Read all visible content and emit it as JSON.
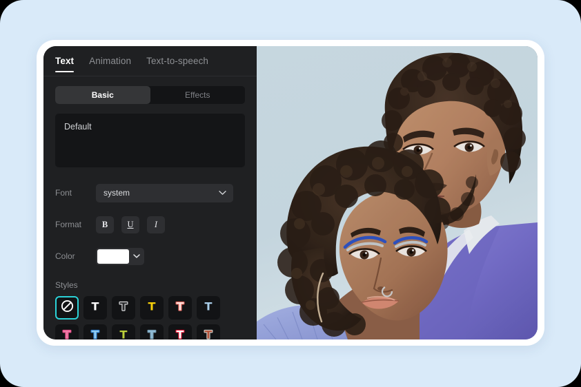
{
  "page": {
    "background_color": "#d9eaf9",
    "frame_color": "#ffffff",
    "panel_color": "#1f2022",
    "accent_color": "#2bd3d8"
  },
  "editor": {
    "tabs": [
      {
        "label": "Text",
        "active": true
      },
      {
        "label": "Animation",
        "active": false
      },
      {
        "label": "Text-to-speech",
        "active": false
      }
    ],
    "segmented": [
      {
        "label": "Basic",
        "active": true
      },
      {
        "label": "Effects",
        "active": false
      }
    ],
    "text_input": {
      "value": "Default",
      "placeholder": "Default"
    },
    "font": {
      "label": "Font",
      "value": "system",
      "chevron_icon": "chevron-down-icon"
    },
    "format": {
      "label": "Format",
      "buttons": [
        {
          "name": "bold-button",
          "glyph": "B"
        },
        {
          "name": "underline-button",
          "glyph": "U"
        },
        {
          "name": "italic-button",
          "glyph": "I"
        }
      ]
    },
    "color": {
      "label": "Color",
      "value": "#ffffff",
      "chevron_icon": "chevron-down-icon"
    },
    "styles": {
      "label": "Styles",
      "items": [
        {
          "name": "style-none",
          "icon": "no-style-icon",
          "selected": true,
          "fill": "#ffffff",
          "stroke": ""
        },
        {
          "name": "style-white",
          "icon": "text-style-icon",
          "selected": false,
          "fill": "#ffffff",
          "stroke": ""
        },
        {
          "name": "style-outline-white",
          "icon": "text-style-icon",
          "selected": false,
          "fill": "#2a2b2d",
          "stroke": "#e8e9eb"
        },
        {
          "name": "style-yellow",
          "icon": "text-style-icon",
          "selected": false,
          "fill": "#f5cf0a",
          "stroke": ""
        },
        {
          "name": "style-white-red-outline",
          "icon": "text-style-icon",
          "selected": false,
          "fill": "#fbe2dd",
          "stroke": "#e9675d"
        },
        {
          "name": "style-light-blue",
          "icon": "text-style-icon",
          "selected": false,
          "fill": "#a8cde8",
          "stroke": ""
        },
        {
          "name": "style-pink",
          "icon": "text-style-icon",
          "selected": false,
          "fill": "#f07ba6",
          "stroke": "#e14a85"
        },
        {
          "name": "style-blue-outline",
          "icon": "text-style-icon",
          "selected": false,
          "fill": "#8fcbf0",
          "stroke": "#2f7fd0"
        },
        {
          "name": "style-lime",
          "icon": "text-style-icon",
          "selected": false,
          "fill": "#bcd03a",
          "stroke": ""
        },
        {
          "name": "style-steel-blue",
          "icon": "text-style-icon",
          "selected": false,
          "fill": "#90bcd6",
          "stroke": "#6f93a8"
        },
        {
          "name": "style-white-crimson-outline",
          "icon": "text-style-icon",
          "selected": false,
          "fill": "#ffffff",
          "stroke": "#e8102f"
        },
        {
          "name": "style-rust",
          "icon": "text-style-icon",
          "selected": false,
          "fill": "#b4543c",
          "stroke": "#cfcfca"
        },
        {
          "name": "style-pale-yellow",
          "icon": "text-style-icon",
          "selected": false,
          "fill": "#e8e8b0",
          "stroke": "#9a9a5a"
        },
        {
          "name": "style-salmon",
          "icon": "text-style-icon",
          "selected": false,
          "fill": "#d98b87",
          "stroke": "#f0c5c0"
        }
      ]
    }
  },
  "preview": {
    "name": "video-preview-photo",
    "description": "Photo of two people embracing against a pale blue backdrop; man in a purple blazer",
    "backdrop_color": "#cbdce5",
    "blazer_color": "#7b74cf"
  }
}
